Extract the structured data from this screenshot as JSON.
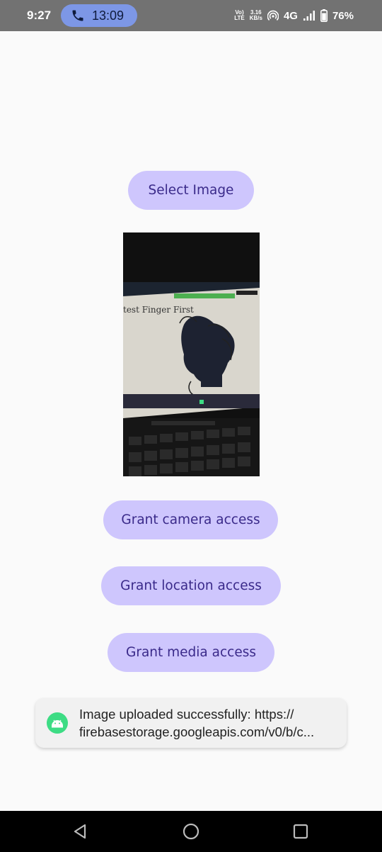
{
  "status_bar": {
    "time": "9:27",
    "call_timer": "13:09",
    "volte_line1": "Vo)",
    "volte_line2": "LTE",
    "speed_value": "3.16",
    "speed_unit": "KB/s",
    "network": "4G",
    "battery": "76%"
  },
  "buttons": {
    "select_image": "Select Image",
    "grant_camera": "Grant camera access",
    "grant_location": "Grant location access",
    "grant_media": "Grant media access"
  },
  "photo": {
    "slide_text": "test Finger First"
  },
  "toast": {
    "line1": "Image uploaded successfully: https://",
    "line2": "firebasestorage.googleapis.com/v0/b/c..."
  },
  "colors": {
    "button_bg": "#cec6fd",
    "button_text": "#3a2a8a",
    "status_bar": "#727272",
    "call_chip": "#7d97e6",
    "android_green": "#3ddc84"
  }
}
